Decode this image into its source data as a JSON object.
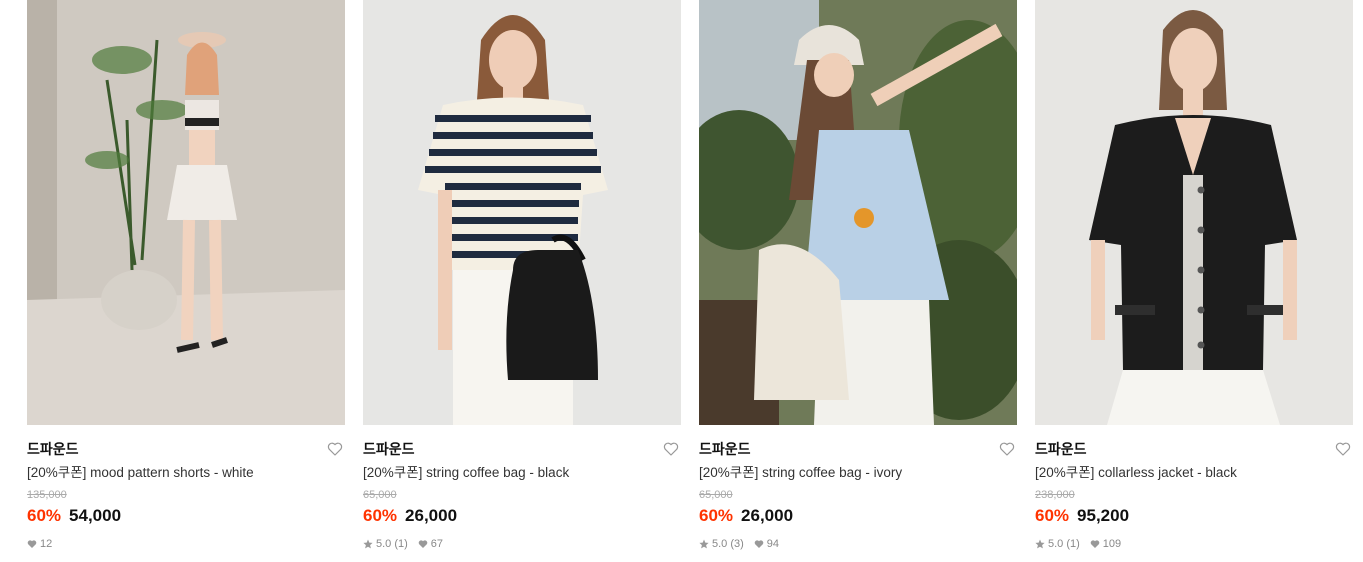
{
  "products": [
    {
      "brand": "드파운드",
      "name": "[20%쿠폰] mood pattern shorts - white",
      "original_price": "135,000",
      "discount": "60%",
      "price": "54,000",
      "rating": "",
      "likes": "12",
      "wishlisted": false
    },
    {
      "brand": "드파운드",
      "name": "[20%쿠폰] string coffee bag - black",
      "original_price": "65,000",
      "discount": "60%",
      "price": "26,000",
      "rating": "5.0 (1)",
      "likes": "67",
      "wishlisted": false
    },
    {
      "brand": "드파운드",
      "name": "[20%쿠폰] string coffee bag - ivory",
      "original_price": "65,000",
      "discount": "60%",
      "price": "26,000",
      "rating": "5.0 (3)",
      "likes": "94",
      "wishlisted": false
    },
    {
      "brand": "드파운드",
      "name": "[20%쿠폰] collarless jacket - black",
      "original_price": "238,000",
      "discount": "60%",
      "price": "95,200",
      "rating": "5.0 (1)",
      "likes": "109",
      "wishlisted": false
    }
  ],
  "colors": {
    "discount": "#ff3300",
    "muted": "#888888"
  },
  "icons": {
    "wishlist": "heart-outline-icon",
    "rating": "star-icon",
    "likes": "heart-filled-icon"
  }
}
